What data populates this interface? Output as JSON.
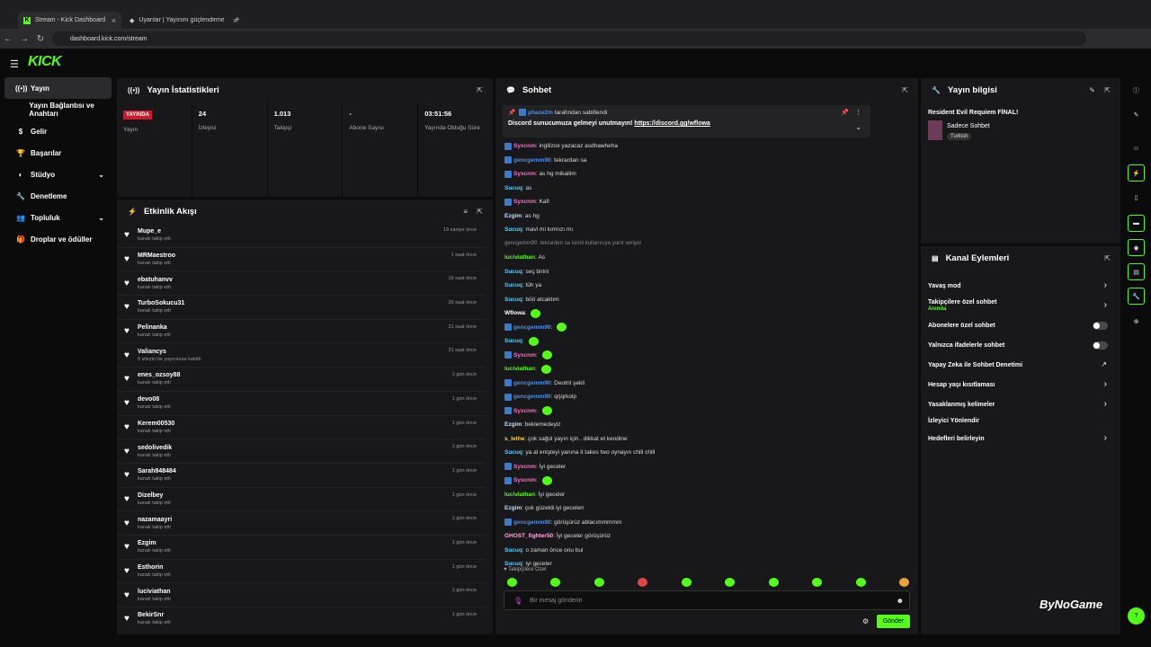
{
  "browser": {
    "tab1": "Stream - Kick Dashboard",
    "tab2": "Uyarılar | Yayınını güçlendirme",
    "url": "dashboard.kick.com/stream"
  },
  "logo": "KICK",
  "sidebar": [
    "Yayın",
    "Yayın Bağlantısı ve Anahtarı",
    "Gelir",
    "Başarılar",
    "Stüdyo",
    "Denetleme",
    "Topluluk",
    "Droplar ve ödüller"
  ],
  "stats": {
    "title": "Yayın İstatistikleri",
    "live": "YAYINDA",
    "live_label": "Yayın",
    "items": [
      {
        "v": "24",
        "l": "İzleyici"
      },
      {
        "v": "1.013",
        "l": "Takipçi"
      },
      {
        "v": "-",
        "l": "Abone Sayısı"
      },
      {
        "v": "03:51:56",
        "l": "Yayında Olduğu Süre"
      }
    ]
  },
  "events": {
    "title": "Etkinlik Akışı",
    "items": [
      {
        "n": "Mupe_e",
        "s": "kanalı takip etti",
        "t": "19 saniye önce"
      },
      {
        "n": "MRMaestroo",
        "s": "kanalı takip etti",
        "t": "1 saat önce"
      },
      {
        "n": "ebatuhanvv",
        "s": "kanalı takip etti",
        "t": "19 saat önce"
      },
      {
        "n": "TurboSokucu31",
        "s": "kanalı takip etti",
        "t": "20 saat önce"
      },
      {
        "n": "Pelinanka",
        "s": "kanalı takip etti",
        "t": "21 saat önce"
      },
      {
        "n": "Valiancys",
        "s": "5 izleyici ile yayınınıza katıldı",
        "t": "21 saat önce"
      },
      {
        "n": "enes_ozsoy88",
        "s": "kanalı takip etti",
        "t": "1 gün önce"
      },
      {
        "n": "devo08",
        "s": "kanalı takip etti",
        "t": "1 gün önce"
      },
      {
        "n": "Kerem00530",
        "s": "kanalı takip etti",
        "t": "1 gün önce"
      },
      {
        "n": "sedolivedik",
        "s": "kanalı takip etti",
        "t": "1 gün önce"
      },
      {
        "n": "Sarah848484",
        "s": "kanalı takip etti",
        "t": "1 gün önce"
      },
      {
        "n": "Dizelbey",
        "s": "kanalı takip etti",
        "t": "1 gün önce"
      },
      {
        "n": "nazamaayri",
        "s": "kanalı takip etti",
        "t": "1 gün önce"
      },
      {
        "n": "Ezgim",
        "s": "kanalı takip etti",
        "t": "1 gün önce"
      },
      {
        "n": "Esthorin",
        "s": "kanalı takip etti",
        "t": "1 gün önce"
      },
      {
        "n": "luciviathan",
        "s": "kanalı takip etti",
        "t": "1 gün önce"
      },
      {
        "n": "BekirSnr",
        "s": "kanalı takip etti",
        "t": "1 gün önce"
      }
    ]
  },
  "chat": {
    "title": "Sohbet",
    "pinned_by": "phaze2m",
    "pinned_suffix": "tarafından sabitlendi",
    "pinned_msg": "Discord sunucumuza gelmeyi unutmayın!",
    "pinned_link": "https://discord.gg/wflowa",
    "lines": [
      {
        "u": "Syxcnm",
        "c": "#ff6ec7",
        "m": "ingilizce yazacaz asdhawheha",
        "b": true
      },
      {
        "u": "gencgemm90",
        "c": "#4a8fe7",
        "m": "tekrardan sa",
        "b": true
      },
      {
        "u": "Syxcnm",
        "c": "#ff6ec7",
        "m": "as hg mikailim",
        "b": true
      },
      {
        "u": "Sucuq",
        "c": "#53d3ff",
        "m": "as"
      },
      {
        "u": "Syxcnm",
        "c": "#ff6ec7",
        "m": "Kafi",
        "b": true
      },
      {
        "u": "Ezgim",
        "c": "#b0e0ff",
        "m": "as hg"
      },
      {
        "u": "Sucuq",
        "c": "#53d3ff",
        "m": "mavi mi kırmızı mı"
      },
      {
        "u": "",
        "c": "#888",
        "m": "gencgemm90: tekrarden sa isimli kullanıcıya yanıt veriyor"
      },
      {
        "u": "luciviathan",
        "c": "#53fc18",
        "m": "As"
      },
      {
        "u": "Sucuq",
        "c": "#53d3ff",
        "m": "seç birini"
      },
      {
        "u": "Sucuq",
        "c": "#53d3ff",
        "m": "tüh ya"
      },
      {
        "u": "Sucuq",
        "c": "#53d3ff",
        "m": "böö atcaktım"
      },
      {
        "u": "Wflowa",
        "c": "#fff",
        "m": "",
        "e": true
      },
      {
        "u": "gencgemm90",
        "c": "#4a8fe7",
        "m": "",
        "e": true,
        "b": true
      },
      {
        "u": "Sucuq",
        "c": "#53d3ff",
        "m": "",
        "e": true
      },
      {
        "u": "Syxcnm",
        "c": "#ff6ec7",
        "m": "",
        "e": true,
        "b": true
      },
      {
        "u": "luciviathan",
        "c": "#53fc18",
        "m": "",
        "e": true
      },
      {
        "u": "gencgemm90",
        "c": "#4a8fe7",
        "m": "Deotrit şekli",
        "b": true
      },
      {
        "u": "gencgemm90",
        "c": "#4a8fe7",
        "m": "qrjqrkolp",
        "b": true
      },
      {
        "u": "Syxcnm",
        "c": "#ff6ec7",
        "m": "",
        "e": true,
        "b": true
      },
      {
        "u": "Ezgim",
        "c": "#b0e0ff",
        "m": "beklemedeyiz"
      },
      {
        "u": "s_lethe",
        "c": "#f5d142",
        "m": "çok sağol yayın için.. dikkat et kendine"
      },
      {
        "u": "Sucuq",
        "c": "#53d3ff",
        "m": "ya al enişteyi yanına it takes two oynayın chill chill"
      },
      {
        "u": "Syxcnm",
        "c": "#ff6ec7",
        "m": "İyi geceler",
        "b": true
      },
      {
        "u": "Syxcnm",
        "c": "#ff6ec7",
        "m": "",
        "e": true,
        "b": true
      },
      {
        "u": "luciviathan",
        "c": "#53fc18",
        "m": "İyi geceler"
      },
      {
        "u": "Ezgim",
        "c": "#b0e0ff",
        "m": "çok güzeldi iyi gecelerr"
      },
      {
        "u": "gencgemm90",
        "c": "#4a8fe7",
        "m": "görüşürüz ablacımmmmm",
        "b": true
      },
      {
        "u": "GHOST_fighter50",
        "c": "#ffa8e0",
        "m": "İyi geceler görüşürüz"
      },
      {
        "u": "Sucuq",
        "c": "#53d3ff",
        "m": "o zaman önce onu bul"
      },
      {
        "u": "Sucuq",
        "c": "#53d3ff",
        "m": "iyi geceler"
      }
    ],
    "followers_only": "Takipçilere Özel",
    "placeholder": "Bir mesaj gönderin",
    "send": "Gönder"
  },
  "info": {
    "title": "Yayın bilgisi",
    "stream_title": "Resident Evil Requiem FİNAL!",
    "category": "Sadece Sohbet",
    "tag": "Turkish"
  },
  "actions": {
    "title": "Kanal Eylemleri",
    "items": [
      "Yavaş mod",
      "Takipçilere özel sohbet",
      "Abonelere özel sohbet",
      "Yalnızca ifadelerle sohbet",
      "Yapay Zeka ile Sohbet Denetimi",
      "Hesap yaşı kısıtlaması",
      "Yasaklanmış kelimeler",
      "İzleyici Yönlendir",
      "Hedefleri belirleyin"
    ],
    "sub": "Anında"
  },
  "watermark": "ByNoGame"
}
